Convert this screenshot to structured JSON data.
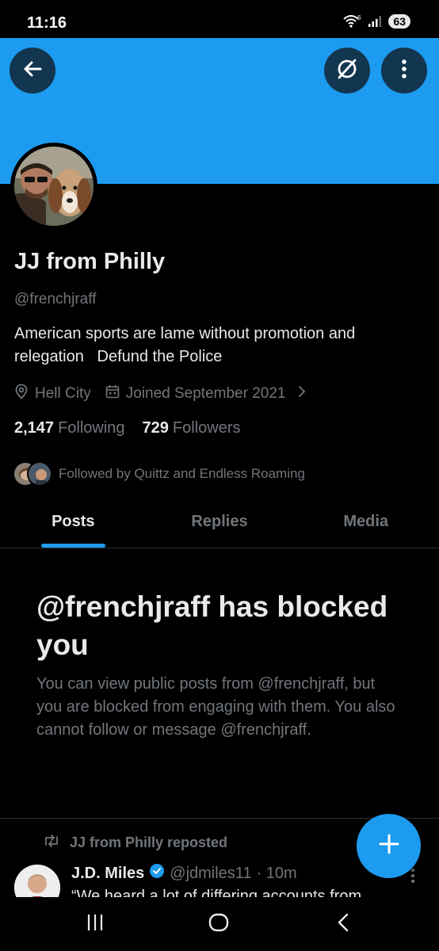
{
  "status_bar": {
    "time": "11:16",
    "battery": "63",
    "wifi_label": "6"
  },
  "header": {
    "back_icon": "arrow-left-icon",
    "grok_icon": "slashed-circle-icon",
    "more_icon": "more-vertical-icon",
    "banner_color": "#1d9bf0"
  },
  "profile": {
    "display_name": "JJ from Philly",
    "handle": "@frenchjraff",
    "bio_line1": "American sports are lame without promotion and",
    "bio_line2": "relegation   Defund the Police",
    "location": "Hell City",
    "joined": "Joined September 2021",
    "following_count": "2,147",
    "following_label": "Following",
    "followers_count": "729",
    "followers_label": "Followers",
    "followed_by": "Followed by Quittz and Endless Roaming"
  },
  "tabs": [
    {
      "label": "Posts",
      "active": true
    },
    {
      "label": "Replies",
      "active": false
    },
    {
      "label": "Media",
      "active": false
    }
  ],
  "blocked": {
    "title": "@frenchjraff has blocked you",
    "description": "You can view public posts from @frenchjraff, but you are blocked from engaging with them. You also cannot follow or message @frenchjraff."
  },
  "repost": {
    "label": "JJ from Philly reposted",
    "author_name": "J.D. Miles",
    "author_handle": "@jdmiles11",
    "time": "· 10m",
    "text": "“We heard a lot of differing accounts from"
  },
  "accent_color": "#1d9bf0"
}
